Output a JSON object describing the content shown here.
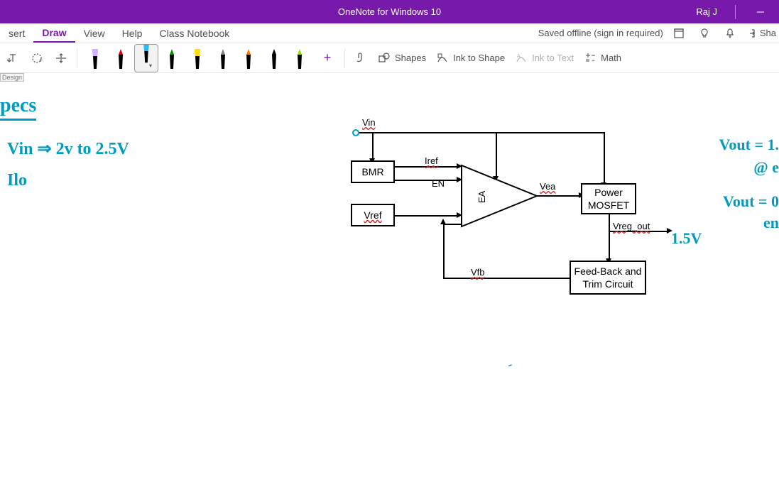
{
  "titlebar": {
    "app_title": "OneNote for Windows 10",
    "user": "Raj J"
  },
  "menu": {
    "insert": "sert",
    "draw": "Draw",
    "view": "View",
    "help": "Help",
    "class_nb": "Class Notebook",
    "save_status": "Saved offline (sign in required)",
    "share": "Sha"
  },
  "ribbon": {
    "shapes": "Shapes",
    "ink_to_shape": "Ink to Shape",
    "ink_to_text": "Ink to Text",
    "math": "Math"
  },
  "pens": [
    {
      "name": "lavender-highlighter",
      "tip": "#d0b0ff",
      "body": "#000"
    },
    {
      "name": "red-pen",
      "tip": "#d00000",
      "body": "#000"
    },
    {
      "name": "blue-highlighter",
      "tip": "#22b8ff",
      "body": "#000",
      "selected": true
    },
    {
      "name": "green-pen",
      "tip": "#009000",
      "body": "#000"
    },
    {
      "name": "yellow-highlighter",
      "tip": "#ffe000",
      "body": "#000"
    },
    {
      "name": "gray-pen",
      "tip": "#808080",
      "body": "#000"
    },
    {
      "name": "orange-pen",
      "tip": "#ff7800",
      "body": "#000"
    },
    {
      "name": "black-pen",
      "tip": "#000",
      "body": "#000"
    },
    {
      "name": "lime-pen",
      "tip": "#8cdc00",
      "body": "#000"
    }
  ],
  "canvas": {
    "ruler_text": "Design",
    "specs_heading": "pecs",
    "spec_vin": "Vin ⇒ 2v to 2.5V",
    "spec_iload": "Ilo",
    "ink_1p5v": "1.5V",
    "ink_vout1": "Vout  = 1.",
    "ink_at_e": "@ e",
    "ink_vout0": "Vout = 0",
    "ink_en": "en",
    "diagram": {
      "vin": "Vin",
      "bmr": "BMR",
      "vref": "Vref",
      "iref": "Iref",
      "en": "EN",
      "ea": "EA",
      "vea": "Vea",
      "mosfet_l1": "Power",
      "mosfet_l2": "MOSFET",
      "vreg": "Vreg_out",
      "fb_l1": "Feed-Back and",
      "fb_l2": "Trim Circuit",
      "vfb": "Vfb"
    }
  }
}
